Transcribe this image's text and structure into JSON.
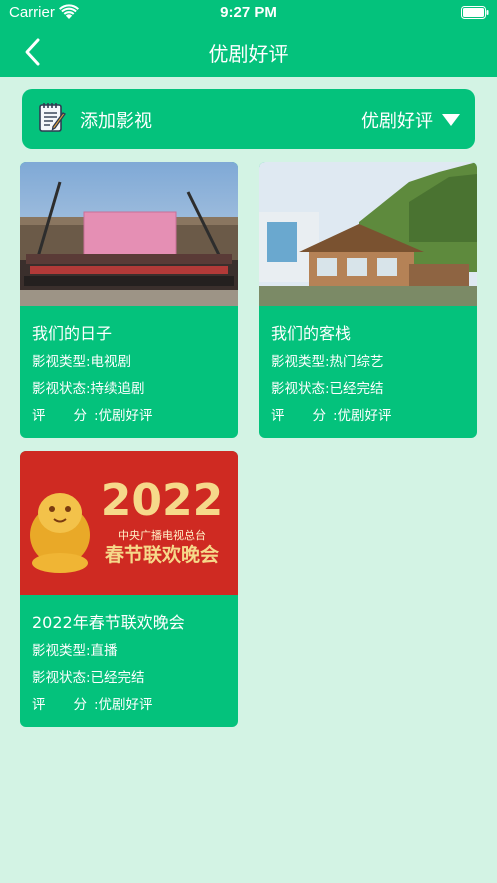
{
  "status_bar": {
    "carrier": "Carrier",
    "time": "9:27 PM"
  },
  "nav": {
    "title": "优剧好评"
  },
  "filter": {
    "add_label": "添加影视",
    "selected": "优剧好评"
  },
  "colors": {
    "primary": "#04c27c",
    "background": "#d3f3e4"
  },
  "cards": [
    {
      "title": "我们的日子",
      "type": "影视类型:电视剧",
      "status": "影视状态:持续追剧",
      "score_label_a": "评",
      "score_label_b": "分",
      "score_value": ":优剧好评"
    },
    {
      "title": "我们的客栈",
      "type": "影视类型:热门综艺",
      "status": "影视状态:已经完结",
      "score_label_a": "评",
      "score_label_b": "分",
      "score_value": ":优剧好评"
    },
    {
      "title": "2022年春节联欢晚会",
      "type": "影视类型:直播",
      "status": "影视状态:已经完结",
      "score_label_a": "评",
      "score_label_b": "分",
      "score_value": ":优剧好评",
      "poster_year": "2022",
      "poster_org": "中央广播电视总台",
      "poster_title": "春节联欢晚会"
    }
  ]
}
